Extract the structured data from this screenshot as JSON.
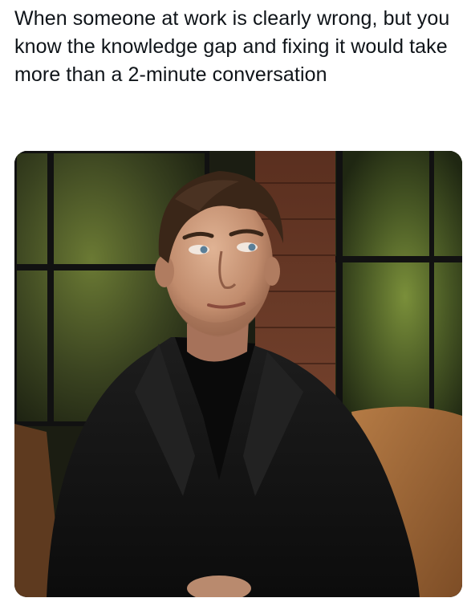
{
  "post": {
    "caption": "When someone at work is clearly wrong, but you know the knowledge gap and fixing it would take more than a 2-minute conversation"
  },
  "image": {
    "subject": "man-in-black-suit",
    "setting": "tv-studio-interview",
    "colors": {
      "background_window": "#3f4a25",
      "brick_wall": "#6b3b26",
      "leather_chair": "#a8703c",
      "suit": "#141414",
      "skin": "#c99679",
      "hair": "#3a2618"
    }
  }
}
